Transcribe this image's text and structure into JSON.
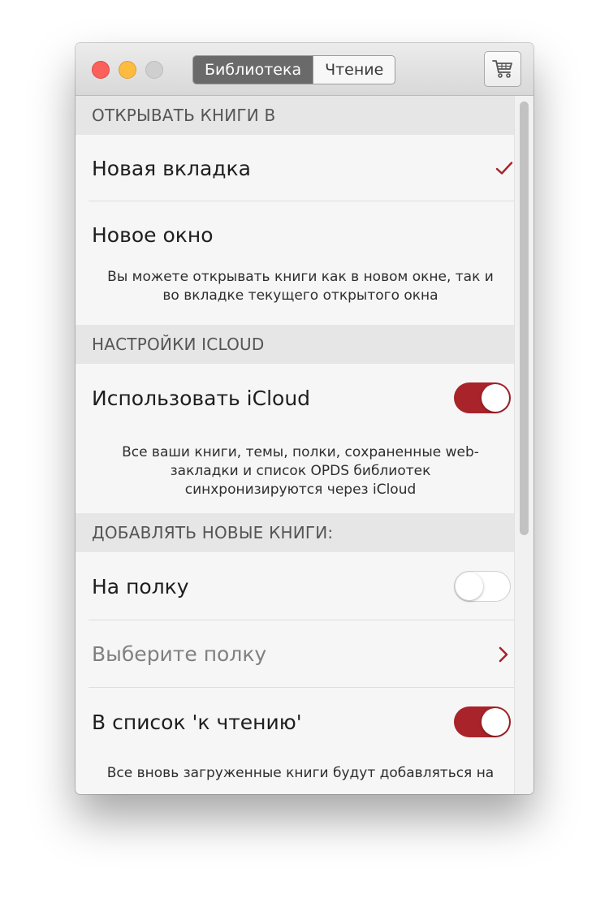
{
  "tabs": [
    {
      "label": "Библиотека",
      "active": true
    },
    {
      "label": "Чтение",
      "active": false
    }
  ],
  "toolbar": {
    "cart_icon": "cart-icon"
  },
  "sections": {
    "open_books": {
      "header": "ОТКРЫВАТЬ КНИГИ В",
      "new_tab": {
        "label": "Новая вкладка",
        "checked": true
      },
      "new_window": {
        "label": "Новое окно",
        "checked": false
      },
      "footnote": "Вы можете открывать книги как в новом окне, так и во вкладке текущего открытого окна"
    },
    "icloud": {
      "header": "НАСТРОЙКИ ICLOUD",
      "use_icloud": {
        "label": "Использовать iCloud",
        "on": true
      },
      "footnote": "Все ваши книги, темы, полки, сохраненные web-закладки и список OPDS библиотек синхронизируются через iCloud"
    },
    "add_books": {
      "header": "ДОБАВЛЯТЬ НОВЫЕ КНИГИ:",
      "to_shelf": {
        "label": "На полку",
        "on": false
      },
      "choose_shelf": {
        "label": "Выберите полку"
      },
      "to_reading_list": {
        "label": "В список 'к чтению'",
        "on": true
      },
      "footnote": "Все вновь загруженные книги будут добавляться на"
    }
  },
  "colors": {
    "accent": "#a8232a",
    "close": "#fc605b",
    "minimize": "#fdbc40",
    "zoom": "#cfcfcf"
  }
}
